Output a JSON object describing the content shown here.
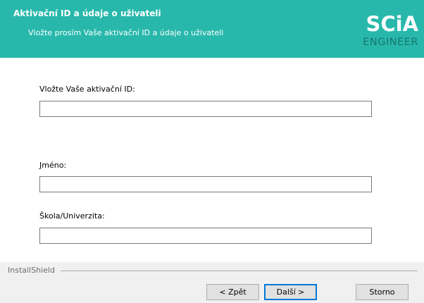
{
  "header": {
    "title": "Aktivační ID a údaje o uživateli",
    "subtitle": "Vložte prosím Vaše aktivační ID a údaje o uživateli",
    "logo": {
      "top": "SCiA",
      "bottom": "ENGINEER"
    },
    "background_color": "#28b8ab"
  },
  "form": {
    "activation": {
      "label": "Vložte Vaše aktivační ID:",
      "value": ""
    },
    "name": {
      "label_accel": "J",
      "label_rest": "méno:",
      "value": ""
    },
    "school": {
      "label": "Škola/Univerzita:",
      "value": ""
    }
  },
  "footer": {
    "brand": "InstallShield",
    "buttons": {
      "back": "< Zpět",
      "next": "Další >",
      "cancel": "Storno"
    }
  }
}
